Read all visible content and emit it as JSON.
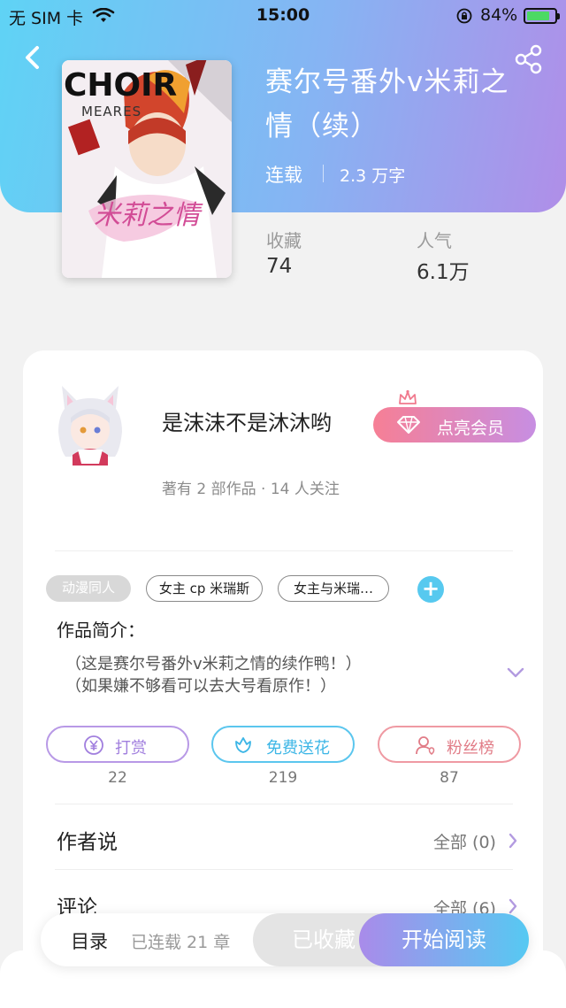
{
  "status_bar": {
    "carrier": "无 SIM 卡",
    "time": "15:00",
    "battery_pct": "84%"
  },
  "book": {
    "title": "赛尔号番外v米莉之情（续）",
    "status": "连载",
    "word_count": "2.3 万字",
    "cover": {
      "title_text": "CHOIR",
      "subtitle_text": "MEARES",
      "art_text": "米莉之情"
    },
    "stats": [
      {
        "label": "收藏",
        "value": "74"
      },
      {
        "label": "人气",
        "value": "6.1万"
      }
    ]
  },
  "author": {
    "name": "是沫沫不是沐沐哟",
    "meta": "著有 2 部作品 · 14 人关注",
    "vip_button": "点亮会员"
  },
  "tags": [
    "动漫同人",
    "女主 cp 米瑞斯",
    "女主与米瑞…"
  ],
  "tag_add": "+",
  "intro": {
    "title": "作品简介：",
    "lines": [
      "（这是赛尔号番外v米莉之情的续作鸭！）",
      "（如果嫌不够看可以去大号看原作！）"
    ]
  },
  "actions": [
    {
      "label": "打赏",
      "count": "22"
    },
    {
      "label": "免费送花",
      "count": "219"
    },
    {
      "label": "粉丝榜",
      "count": "87"
    }
  ],
  "sections": [
    {
      "title": "作者说",
      "link": "全部 (0)"
    },
    {
      "title": "评论",
      "link": "全部 (6)"
    }
  ],
  "bottom_bar": {
    "toc_label": "目录",
    "toc_count": "已连载 21 章",
    "collected": "已收藏",
    "read": "开始阅读"
  },
  "colors": {
    "accent_purple": "#a98bea",
    "accent_blue": "#56c9f2",
    "vip_pink": "#f67f95"
  }
}
